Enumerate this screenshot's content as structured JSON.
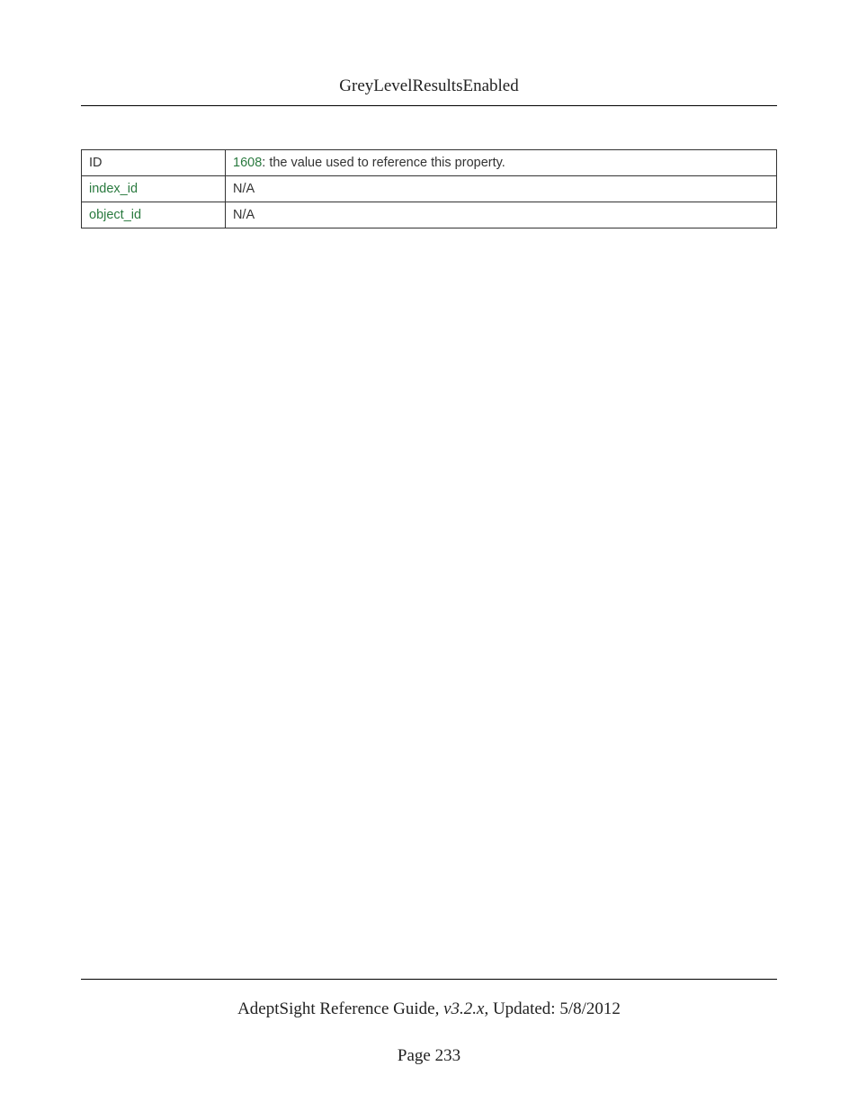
{
  "header": {
    "title": "GreyLevelResultsEnabled"
  },
  "table": {
    "rows": [
      {
        "key": "ID",
        "value_code": "1608",
        "value_rest": ": the value used to reference this property."
      },
      {
        "key": "index_id",
        "value": "N/A"
      },
      {
        "key": "object_id",
        "value": "N/A"
      }
    ]
  },
  "footer": {
    "guide_name": "AdeptSight Reference Guide",
    "version_sep": ", ",
    "version": "v3.2.x",
    "updated_sep": ", Updated: ",
    "updated_date": "5/8/2012",
    "page_label": "Page 233"
  }
}
